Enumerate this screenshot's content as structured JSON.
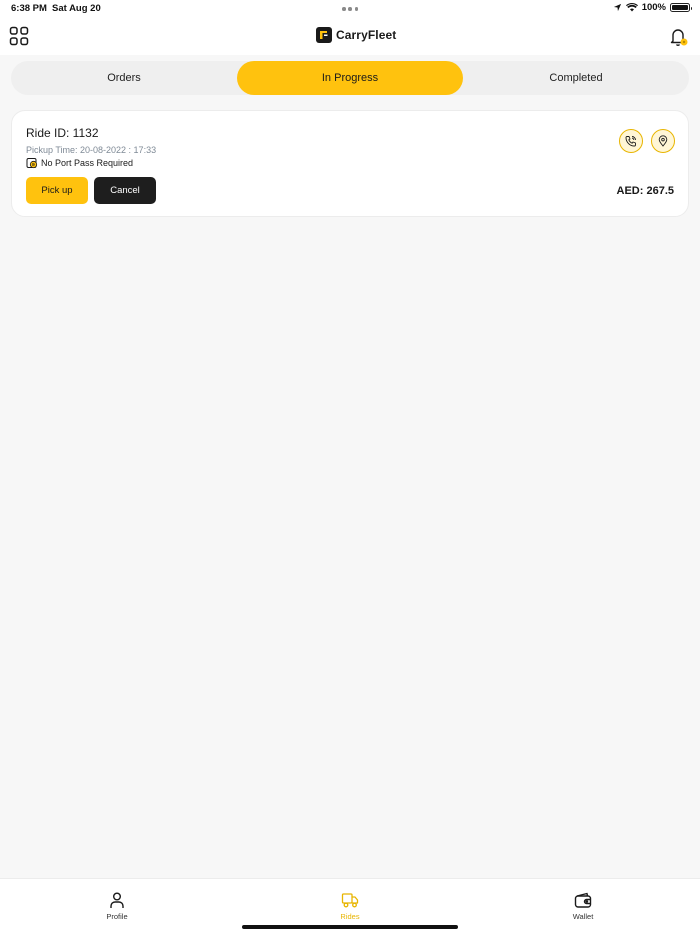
{
  "status_bar": {
    "time": "6:38 PM",
    "date": "Sat Aug 20",
    "battery": "100%"
  },
  "header": {
    "brand_name": "CarryFleet",
    "menu_icon": "grid-icon",
    "notification_icon": "bell-icon"
  },
  "tabs": [
    {
      "label": "Orders",
      "active": false
    },
    {
      "label": "In Progress",
      "active": true
    },
    {
      "label": "Completed",
      "active": false
    }
  ],
  "ride": {
    "id_text": "Ride ID: 1132",
    "pickup_time": "Pickup Time: 20-08-2022 : 17:33",
    "port_pass": "No Port Pass Required",
    "pickup_label": "Pick up",
    "cancel_label": "Cancel",
    "fare": "AED: 267.5"
  },
  "bottom_nav": [
    {
      "label": "Profile",
      "icon": "user-icon"
    },
    {
      "label": "Rides",
      "icon": "truck-icon",
      "active": true
    },
    {
      "label": "Wallet",
      "icon": "wallet-icon"
    }
  ],
  "colors": {
    "accent": "#ffc20e",
    "dark_button": "#1e1e1e",
    "background": "#f7f7f7",
    "muted_text": "#7f8a96"
  }
}
